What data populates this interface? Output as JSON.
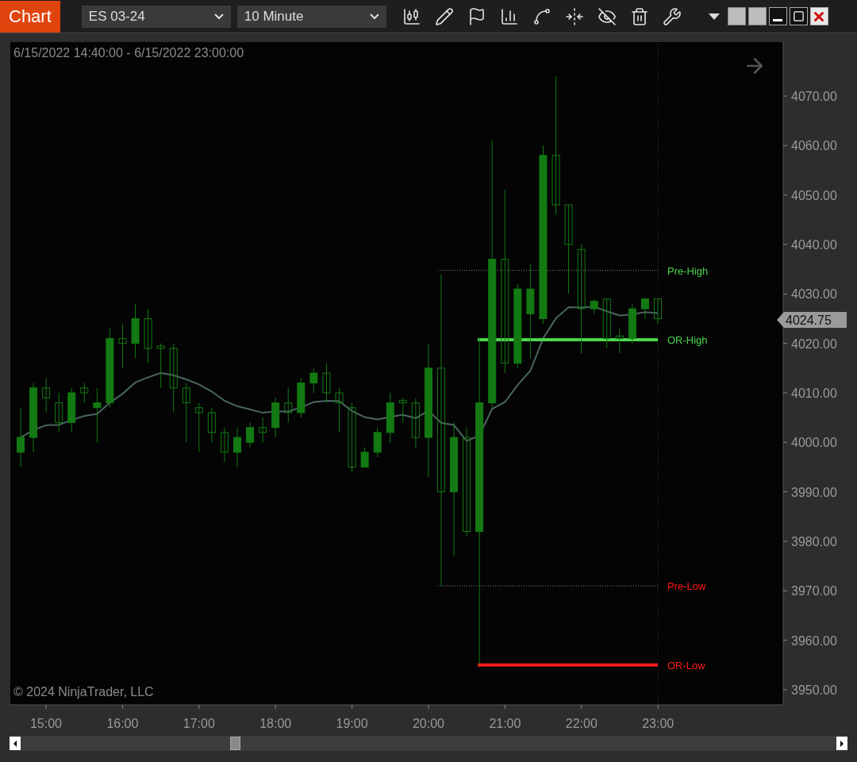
{
  "toolbar": {
    "app_label": "Chart",
    "instrument": "ES 03-24",
    "interval": "10 Minute"
  },
  "chart": {
    "date_range": "6/15/2022 14:40:00 - 6/15/2022 23:00:00",
    "copyright": "© 2024 NinjaTrader, LLC",
    "y_axis_labels": [
      "4070.00",
      "4060.00",
      "4050.00",
      "4040.00",
      "4030.00",
      "4020.00",
      "4010.00",
      "4000.00",
      "3990.00",
      "3980.00",
      "3970.00",
      "3960.00",
      "3950.00"
    ],
    "x_axis_labels": [
      "15:00",
      "16:00",
      "17:00",
      "18:00",
      "19:00",
      "20:00",
      "21:00",
      "22:00",
      "23:00"
    ],
    "last_price": "4024.75",
    "levels": [
      {
        "label": "Pre-High",
        "color": "#4cd44c",
        "kind": "dotted"
      },
      {
        "label": "OR-High",
        "color": "#4cd44c",
        "kind": "solid"
      },
      {
        "label": "Pre-Low",
        "color": "#ff1a1a",
        "kind": "dotted"
      },
      {
        "label": "OR-Low",
        "color": "#ff1a1a",
        "kind": "solid"
      }
    ]
  }
}
